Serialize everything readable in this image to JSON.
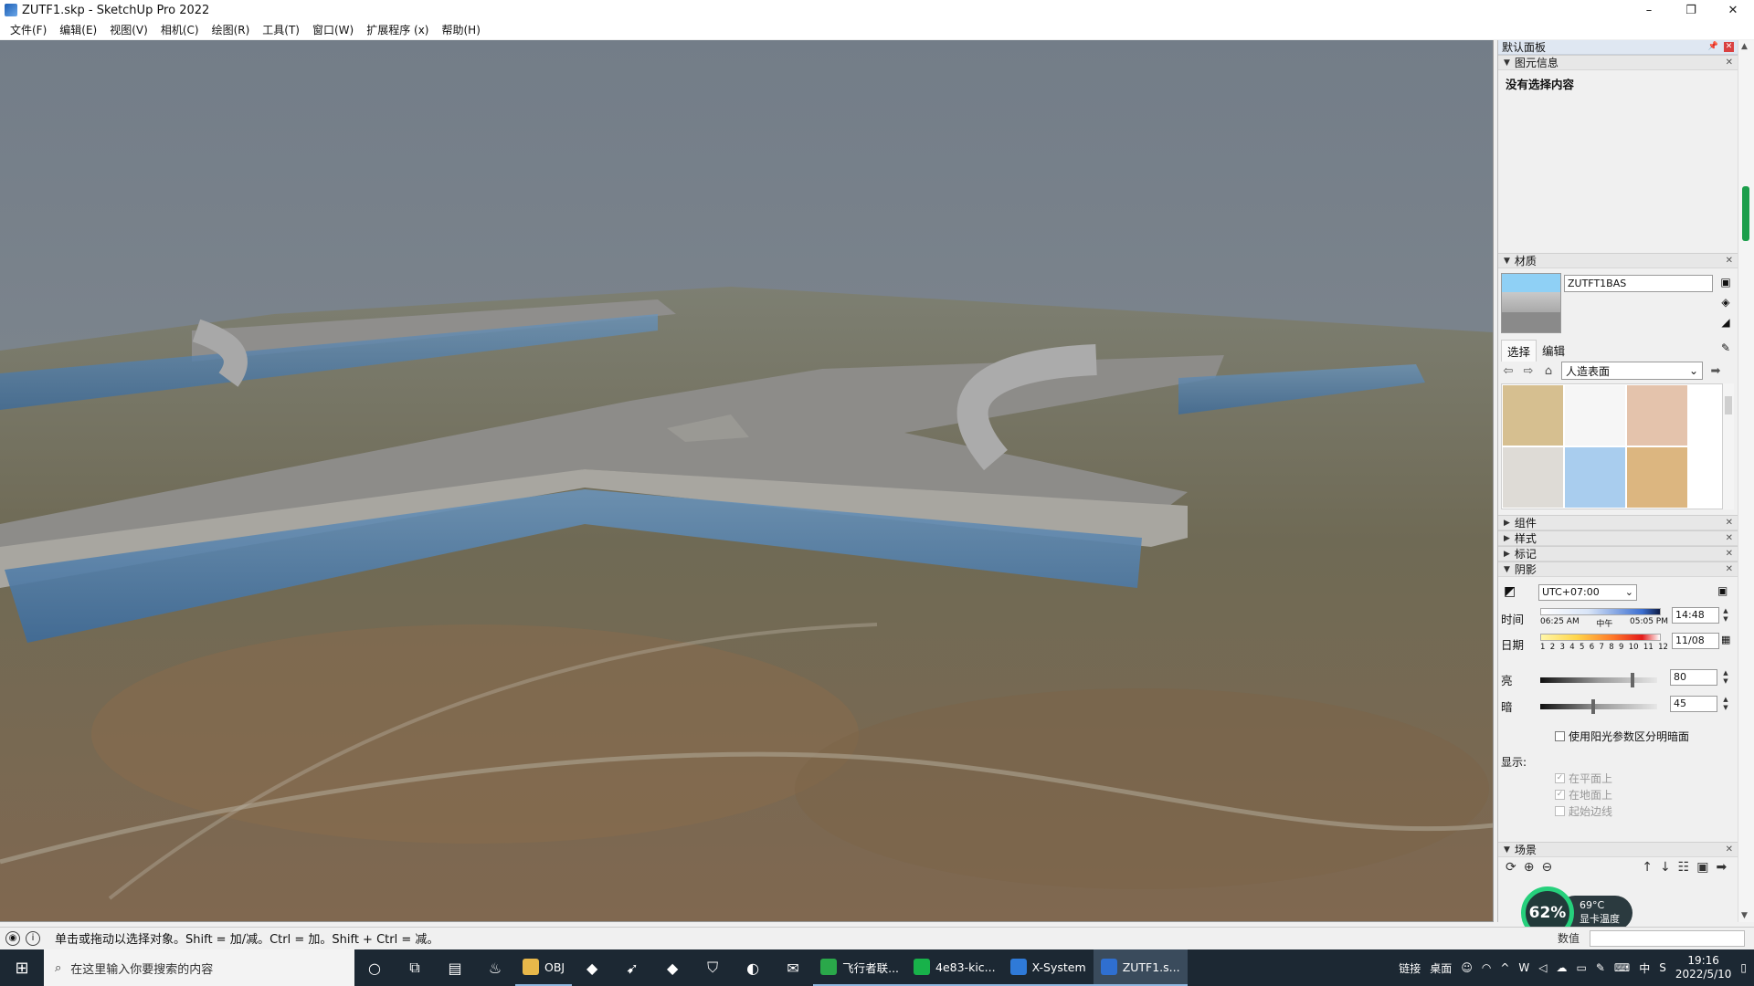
{
  "window": {
    "title": "ZUTF1.skp - SketchUp Pro 2022",
    "minimize": "–",
    "maximize": "❐",
    "close": "✕"
  },
  "menu": [
    "文件(F)",
    "编辑(E)",
    "视图(V)",
    "相机(C)",
    "绘图(R)",
    "工具(T)",
    "窗口(W)",
    "扩展程序 (x)",
    "帮助(H)"
  ],
  "tray": {
    "title": "默认面板",
    "entity_info": {
      "label": "图元信息",
      "content": "没有选择内容"
    },
    "materials": {
      "label": "材质",
      "name": "ZUTFT1BAS",
      "tabs": [
        "选择",
        "编辑"
      ],
      "library": "人造表面",
      "swatch_colors": [
        "#d6bf90",
        "#f6f6f6",
        "#e4c3ac",
        "#dedbd6",
        "#a9cdee",
        "#dcb680"
      ]
    },
    "components": {
      "label": "组件"
    },
    "styles": {
      "label": "样式"
    },
    "tags": {
      "label": "标记"
    },
    "shadows": {
      "label": "阴影",
      "timezone": "UTC+07:00",
      "time_label": "时间",
      "time_start": "06:25 AM",
      "time_mid": "中午",
      "time_end": "05:05 PM",
      "time_value": "14:48",
      "date_label": "日期",
      "months": [
        "1",
        "2",
        "3",
        "4",
        "5",
        "6",
        "7",
        "8",
        "9",
        "10",
        "11",
        "12"
      ],
      "date_value": "11/08",
      "light_label": "亮",
      "light_value": "80",
      "dark_label": "暗",
      "dark_value": "45",
      "use_sun_label": "使用阳光参数区分明暗面",
      "display_label": "显示:",
      "on_faces": "在平面上",
      "on_ground": "在地面上",
      "from_edges": "起始边线"
    },
    "scenes": {
      "label": "场景"
    }
  },
  "gpu_overlay": {
    "usage": "62%",
    "temp": "69°C",
    "temp_label": "显卡温度"
  },
  "status": {
    "message": "单击或拖动以选择对象。Shift = 加/减。Ctrl = 加。Shift + Ctrl = 减。",
    "measure_label": "数值"
  },
  "taskbar": {
    "search_placeholder": "在这里输入你要搜索的内容",
    "apps": [
      {
        "label": "OBJ",
        "color": "#e8b84a"
      },
      {
        "label": "飞行者联...",
        "color": "#2aa84a"
      },
      {
        "label": "4e83-kic...",
        "color": "#18b24a"
      },
      {
        "label": "X-System",
        "color": "#2f7ad8"
      },
      {
        "label": "ZUTF1.s...",
        "color": "#2f6fd0"
      }
    ],
    "tray_links": "链接",
    "tray_desktop": "桌面",
    "ime": "中",
    "time": "19:16",
    "date": "2022/5/10"
  }
}
